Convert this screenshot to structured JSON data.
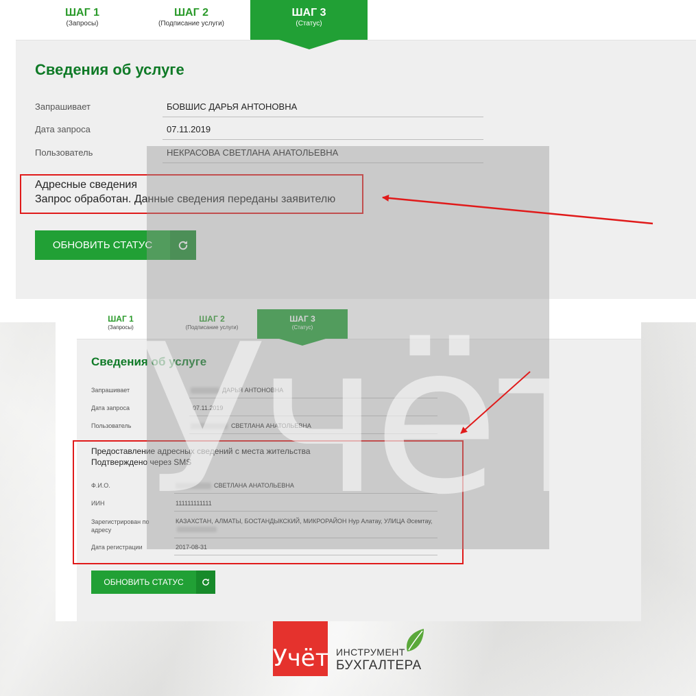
{
  "top": {
    "steps": [
      {
        "title": "ШАГ 1",
        "sub": "(Запросы)"
      },
      {
        "title": "ШАГ 2",
        "sub": "(Подписание услуги)"
      },
      {
        "title": "ШАГ 3",
        "sub": "(Статус)"
      }
    ],
    "section_title": "Сведения об услуге",
    "rows": [
      {
        "label": "Запрашивает",
        "value": "БОВШИС ДАРЬЯ АНТОНОВНА"
      },
      {
        "label": "Дата запроса",
        "value": "07.11.2019"
      },
      {
        "label": "Пользователь",
        "value": "НЕКРАСОВА СВЕТЛАНА АНАТОЛЬЕВНА"
      }
    ],
    "status_line1": "Адресные сведения",
    "status_line2": "Запрос обработан. Данные сведения переданы заявителю",
    "button": "ОБНОВИТЬ СТАТУС"
  },
  "bottom": {
    "steps": [
      {
        "title": "ШАГ 1",
        "sub": "(Запросы)"
      },
      {
        "title": "ШАГ 2",
        "sub": "(Подписание услуги)"
      },
      {
        "title": "ШАГ 3",
        "sub": "(Статус)"
      }
    ],
    "section_title": "Сведения об услуге",
    "rows": [
      {
        "label": "Запрашивает",
        "value": "ДАРЬЯ АНТОНОВНА"
      },
      {
        "label": "Дата запроса",
        "value": "07.11.2019"
      },
      {
        "label": "Пользователь",
        "value": "СВЕТЛАНА АНАТОЛЬЕВНА"
      }
    ],
    "status_line1": "Предоставление адресных сведений с места жительства",
    "status_line2": "Подтверждено через SMS",
    "details": [
      {
        "label": "Ф.И.О.",
        "value": "СВЕТЛАНА АНАТОЛЬЕВНА"
      },
      {
        "label": "ИИН",
        "value": "111111111111"
      },
      {
        "label": "Зарегистрирован по адресу",
        "value": "КАЗАХСТАН, АЛМАТЫ, БОСТАНДЫКСКИЙ, МИКРОРАЙОН Нур Алатау, УЛИЦА Әсемтау,"
      },
      {
        "label": "Дата регистрации",
        "value": "2017-08-31"
      }
    ],
    "button": "ОБНОВИТЬ СТАТУС"
  },
  "watermark": "Учёт",
  "logo": {
    "red_text": "Учёт",
    "line1": "ИНСТРУМЕНТ",
    "line2": "БУХГАЛТЕРА"
  },
  "colors": {
    "green": "#21a035",
    "dark_green": "#0f7a27",
    "red": "#e01a1a",
    "logo_red": "#e5322d"
  }
}
